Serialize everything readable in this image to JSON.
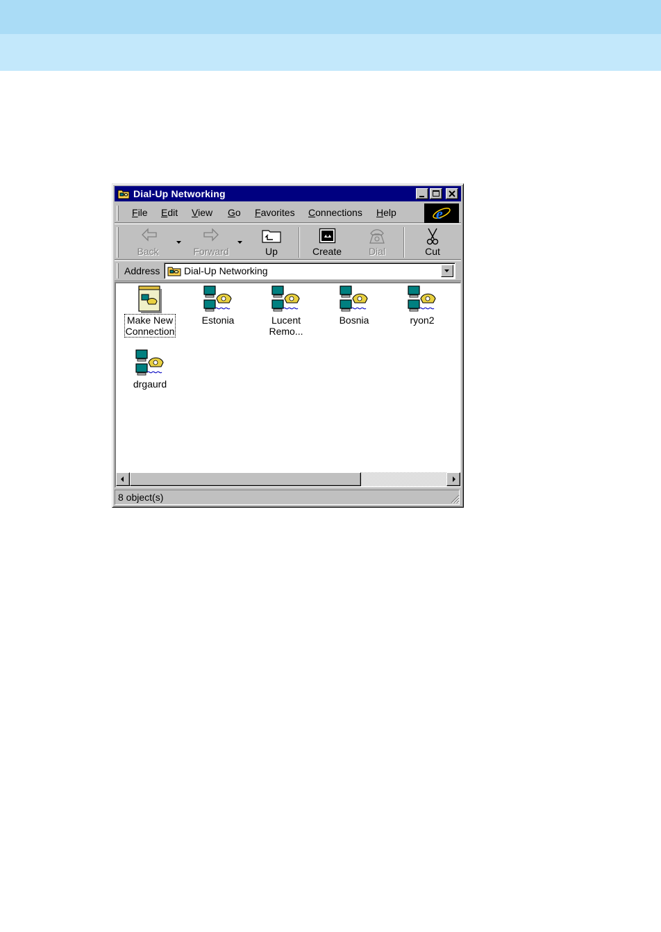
{
  "window": {
    "title": "Dial-Up Networking",
    "title_icon": "dial-up-folder-icon",
    "controls": [
      "minimize-icon",
      "maximize-icon",
      "close-icon"
    ]
  },
  "menu": {
    "items": [
      "File",
      "Edit",
      "View",
      "Go",
      "Favorites",
      "Connections",
      "Help"
    ],
    "logo": "internet-explorer-logo-icon"
  },
  "toolbar": {
    "back": {
      "label": "Back",
      "icon": "back-arrow-icon",
      "enabled": false
    },
    "forward": {
      "label": "Forward",
      "icon": "forward-arrow-icon",
      "enabled": false
    },
    "up": {
      "label": "Up",
      "icon": "up-folder-icon",
      "enabled": true
    },
    "create": {
      "label": "Create",
      "icon": "create-icon",
      "enabled": true
    },
    "dial": {
      "label": "Dial",
      "icon": "dial-phone-icon",
      "enabled": false
    },
    "cut": {
      "label": "Cut",
      "icon": "scissors-icon",
      "enabled": true
    }
  },
  "address": {
    "label": "Address",
    "value": "Dial-Up Networking"
  },
  "items": [
    {
      "name": "Make New\nConnection",
      "icon": "make-new-connection-icon"
    },
    {
      "name": "Estonia",
      "icon": "dial-up-connection-icon"
    },
    {
      "name": "Lucent\nRemo...",
      "icon": "dial-up-connection-icon"
    },
    {
      "name": "Bosnia",
      "icon": "dial-up-connection-icon"
    },
    {
      "name": "ryon2",
      "icon": "dial-up-connection-icon"
    },
    {
      "name": "drgaurd",
      "icon": "dial-up-connection-icon"
    }
  ],
  "status": {
    "text": "8 object(s)"
  },
  "colors": {
    "top_band": "#aadcf6",
    "second_band": "#c3e8fb",
    "title_bar": "#000080",
    "window_face": "#c0c0c0"
  }
}
